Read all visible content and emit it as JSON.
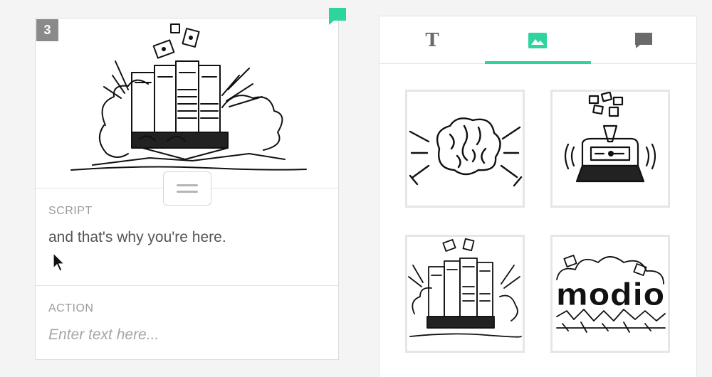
{
  "frame": {
    "number": "3",
    "script": {
      "label": "SCRIPT",
      "text": "and that's why you're here."
    },
    "action": {
      "label": "ACTION",
      "placeholder": "Enter text here..."
    }
  },
  "panel": {
    "tabs": [
      {
        "name": "text",
        "icon": "text-t-icon",
        "glyph": "T",
        "active": false
      },
      {
        "name": "image",
        "icon": "image-icon",
        "active": true
      },
      {
        "name": "comments",
        "icon": "comment-icon",
        "active": false
      }
    ],
    "thumbnails": [
      {
        "name": "brain-sketch"
      },
      {
        "name": "money-machine-sketch"
      },
      {
        "name": "money-vault-sketch"
      },
      {
        "name": "logo-sketch",
        "logo_text": "modio"
      }
    ]
  },
  "colors": {
    "accent": "#2ed39e",
    "frame_badge": "#8a8a8a",
    "label": "#9a9a9a",
    "placeholder": "#a5a5a5"
  }
}
